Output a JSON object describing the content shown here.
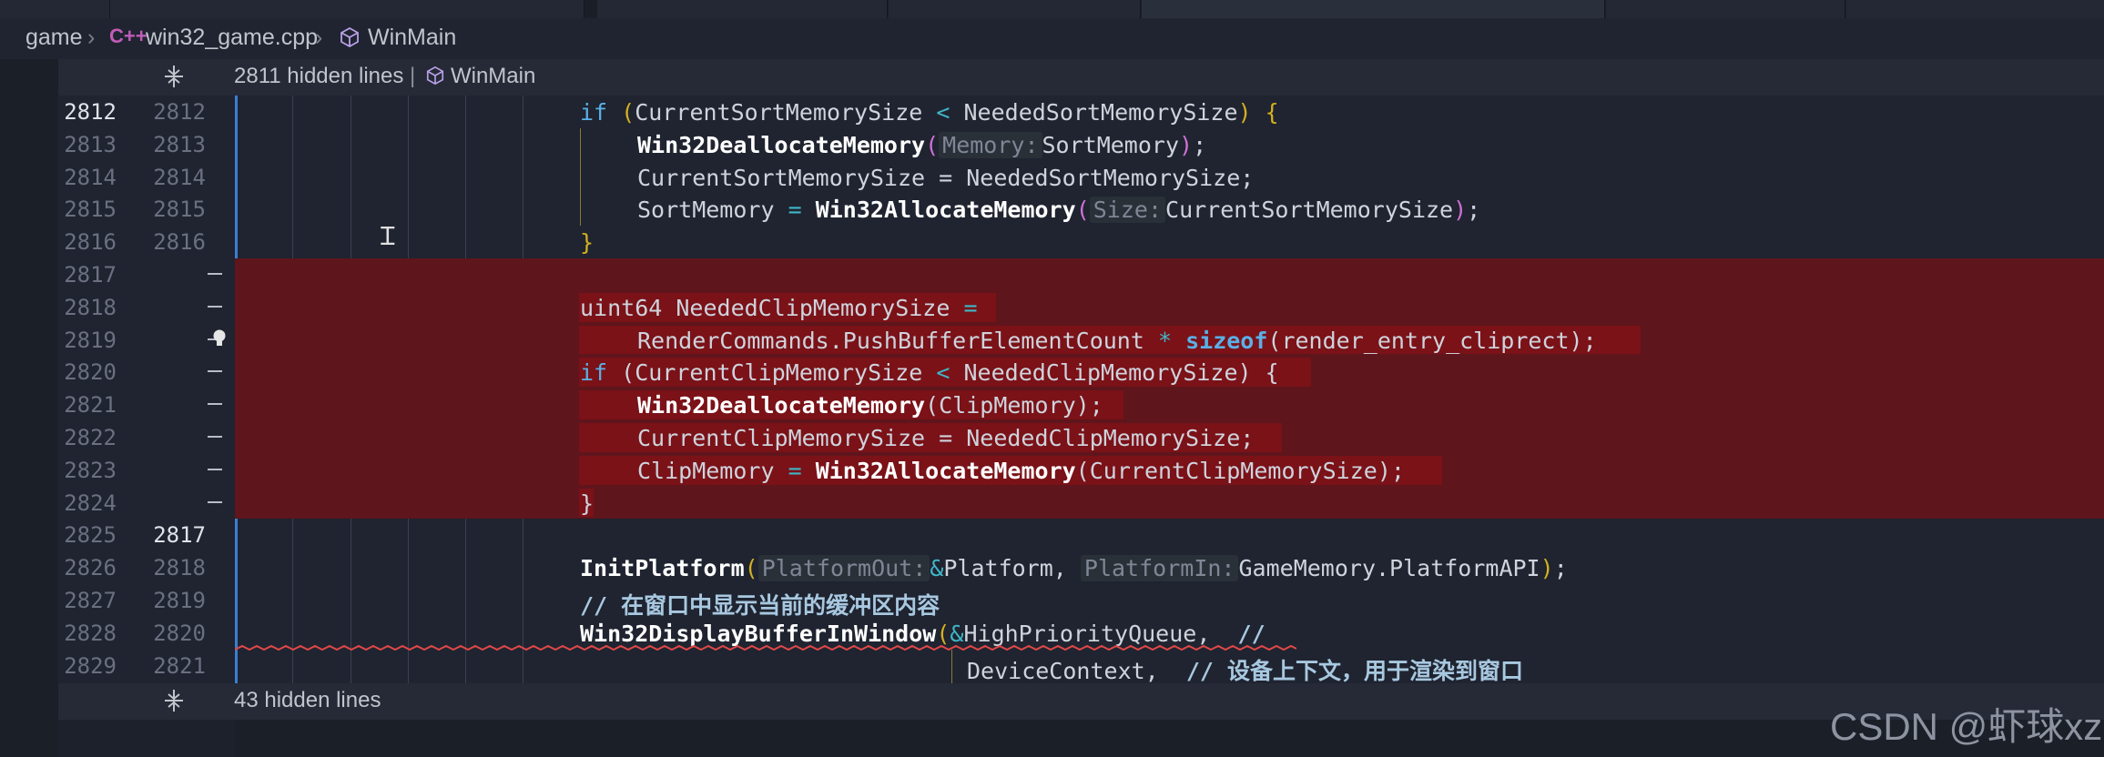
{
  "breadcrumb": {
    "folder": "game",
    "file_icon": "cpp-file-icon",
    "file": "win32_game.cpp",
    "symbol_icon": "cube-icon",
    "symbol": "WinMain"
  },
  "fold_top": {
    "icon": "fold-icon",
    "text": "2811 hidden lines",
    "separator": "|",
    "symbol": "WinMain"
  },
  "fold_bottom": {
    "icon": "fold-icon",
    "text": "43 hidden lines"
  },
  "lines": [
    {
      "left": "2812",
      "right": "2812"
    },
    {
      "left": "2813",
      "right": "2813"
    },
    {
      "left": "2814",
      "right": "2814"
    },
    {
      "left": "2815",
      "right": "2815"
    },
    {
      "left": "2816",
      "right": "2816"
    },
    {
      "left": "2817",
      "right": "—"
    },
    {
      "left": "2818",
      "right": "—"
    },
    {
      "left": "2819",
      "right": "—"
    },
    {
      "left": "2820",
      "right": "—"
    },
    {
      "left": "2821",
      "right": "—"
    },
    {
      "left": "2822",
      "right": "—"
    },
    {
      "left": "2823",
      "right": "—"
    },
    {
      "left": "2824",
      "right": "—"
    },
    {
      "left": "2825",
      "right": "2817"
    },
    {
      "left": "2826",
      "right": "2818"
    },
    {
      "left": "2827",
      "right": "2819"
    },
    {
      "left": "2828",
      "right": "2820"
    },
    {
      "left": "2829",
      "right": "2821"
    }
  ],
  "code": {
    "l2812": {
      "kw": "if",
      "open": "(",
      "a": "CurrentSortMemorySize",
      "op": "<",
      "b": "NeededSortMemorySize",
      "close": ")",
      "brace": "{"
    },
    "l2813": {
      "fn": "Win32DeallocateMemory",
      "open": "(",
      "hint": "Memory:",
      "arg": "SortMemory",
      "close": ")",
      "semi": ";"
    },
    "l2814": {
      "text": "CurrentSortMemorySize = NeededSortMemorySize;"
    },
    "l2815": {
      "a": "SortMemory",
      "op": "=",
      "fn": "Win32AllocateMemory",
      "open": "(",
      "hint": "Size:",
      "arg": "CurrentSortMemorySize",
      "close": ")",
      "semi": ";"
    },
    "l2816": {
      "brace": "}"
    },
    "l2818": {
      "type": "uint64",
      "name": "NeededClipMemorySize",
      "op": "="
    },
    "l2819": {
      "a": "RenderCommands.PushBufferElementCount",
      "op": "*",
      "sz": "sizeof",
      "rest": "(render_entry_cliprect);"
    },
    "l2820": {
      "kw": "if",
      "text": "(CurrentClipMemorySize",
      "op": "<",
      "rest": "NeededClipMemorySize) {"
    },
    "l2821": {
      "fn": "Win32DeallocateMemory",
      "rest": "(ClipMemory);"
    },
    "l2822": {
      "text": "CurrentClipMemorySize = NeededClipMemorySize;"
    },
    "l2823": {
      "a": "ClipMemory",
      "op": "=",
      "fn": "Win32AllocateMemory",
      "rest": "(CurrentClipMemorySize);"
    },
    "l2824": {
      "brace": "}"
    },
    "l2826": {
      "fn": "InitPlatform",
      "open": "(",
      "hint1": "PlatformOut:",
      "amp": "&",
      "arg1": "Platform,",
      "hint2": "PlatformIn:",
      "arg2": "GameMemory.PlatformAPI",
      "close": ")",
      "semi": ";"
    },
    "l2827": {
      "comment": "// 在窗口中显示当前的缓冲区内容"
    },
    "l2828": {
      "fn": "Win32DisplayBufferInWindow",
      "open": "(",
      "amp": "&",
      "arg": "HighPriorityQueue,",
      "comment": "//"
    },
    "l2829": {
      "arg": "DeviceContext,",
      "comment": "// 设备上下文，用于渲染到窗口"
    }
  },
  "watermark": "CSDN @虾球xz",
  "colors": {
    "deleted_bg": "#5e151b",
    "deleted_text_bg": "#7a1218",
    "keyword": "#5ab0e6",
    "bracket": "#d4b020",
    "modified_bar": "#3a7fd0"
  }
}
